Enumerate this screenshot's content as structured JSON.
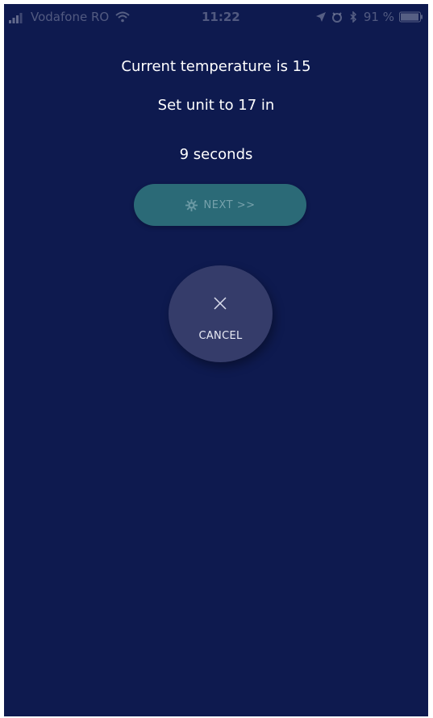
{
  "status_bar": {
    "carrier": "Vodafone RO",
    "time": "11:22",
    "battery": "91 %",
    "icons": [
      "signal-icon",
      "wifi-icon",
      "location-arrow-icon",
      "alarm-icon",
      "bluetooth-icon",
      "battery-icon"
    ]
  },
  "main": {
    "current_temperature_text": "Current temperature is 15",
    "set_unit_text": "Set unit to 17 in",
    "countdown_text": "9 seconds"
  },
  "next_button": {
    "label": "NEXT >>",
    "icon": "gear-icon",
    "background": "#2b6a77"
  },
  "cancel_button": {
    "label": "CANCEL",
    "icon": "close-icon",
    "background": "#353c6a"
  },
  "colors": {
    "screen_background": "#0e1a4f",
    "text": "#ffffff"
  }
}
